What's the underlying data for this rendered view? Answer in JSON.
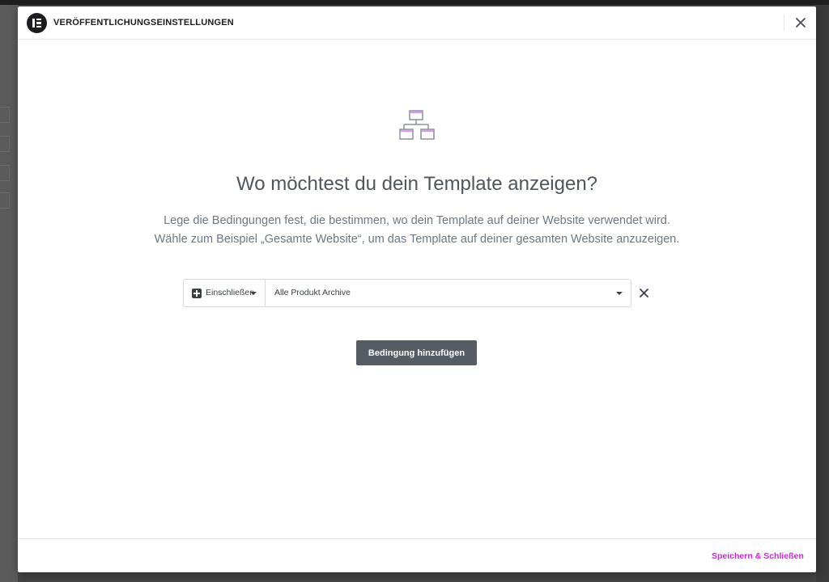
{
  "modal": {
    "title": "VERÖFFENTLICHUNGSEINSTELLUNGEN",
    "heading": "Wo möchtest du dein Template anzeigen?",
    "description_line1": "Lege die Bedingungen fest, die bestimmen, wo dein Template auf deiner Website verwendet wird.",
    "description_line2": "Wähle zum Beispiel „Gesamte Website“, um das Template auf deiner gesamten Website anzuzeigen."
  },
  "condition": {
    "type_label": "Einschließen",
    "value_label": "Alle Produkt Archive"
  },
  "buttons": {
    "add_condition": "Bedingung hinzufügen",
    "save_close": "Speichern & Schließen"
  },
  "icons": {
    "logo": "elementor-logo-icon",
    "close": "close-icon",
    "hero": "sitemap-icon",
    "include": "plus-square-icon",
    "caret": "caret-down-icon",
    "remove": "remove-x-icon"
  },
  "colors": {
    "accent": "#c02fcb",
    "hero_accent": "#d7a0e6",
    "button_bg": "#555c64",
    "heading": "#4f565e"
  }
}
